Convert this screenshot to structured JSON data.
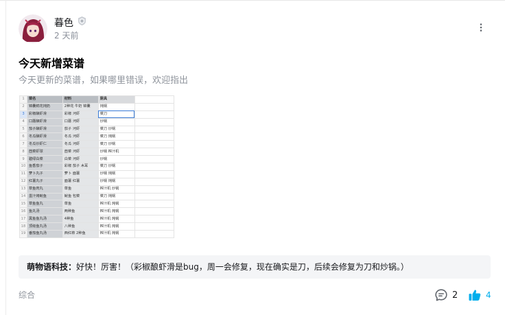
{
  "author": {
    "name": "暮色",
    "time": "2 天前"
  },
  "post": {
    "title": "今天新增菜谱",
    "description": "今天更新的菜谱，如果哪里错误，欢迎指出"
  },
  "sheet": {
    "headers": [
      "菜名",
      "材料",
      "厨具"
    ],
    "rows": [
      {
        "n": "1",
        "name": "",
        "mat": "",
        "tool": ""
      },
      {
        "n": "2",
        "name": "锦囊鲜花炖奶",
        "mat": "2种花 牛奶 锦囊",
        "tool": "炖锅"
      },
      {
        "n": "3",
        "name": "彩椒酿虾滑",
        "mat": "彩椒 河虾",
        "tool": "菜刀"
      },
      {
        "n": "4",
        "name": "口蘑酿虾滑",
        "mat": "口蘑 河虾",
        "tool": "炒锅"
      },
      {
        "n": "5",
        "name": "茄子酿虾滑",
        "mat": "茄子 河虾",
        "tool": "菜刀 炒锅"
      },
      {
        "n": "6",
        "name": "冬瓜酿虾滑",
        "mat": "冬瓜 河虾",
        "tool": "菜刀 炖锅"
      },
      {
        "n": "7",
        "name": "冬瓜炒虾仁",
        "mat": "冬瓜 河虾",
        "tool": "菜刀 炒锅"
      },
      {
        "n": "8",
        "name": "茴菜虾球",
        "mat": "茴菜 河虾",
        "tool": "炒锅 榨汁机"
      },
      {
        "n": "9",
        "name": "碧绿白菜",
        "mat": "白菜 河虾",
        "tool": "炒锅"
      },
      {
        "n": "10",
        "name": "鱼香茄子",
        "mat": "彩椒 茄子 木耳",
        "tool": "菜刀 炒锅"
      },
      {
        "n": "11",
        "name": "萝卜丸子",
        "mat": "萝卜 面薯",
        "tool": "炒锅 炖锅"
      },
      {
        "n": "12",
        "name": "红薯丸子",
        "mat": "面薯 红薯",
        "tool": "炒锅 炖锅"
      },
      {
        "n": "13",
        "name": "草鱼肉丸",
        "mat": "草鱼",
        "tool": "榨汁机 炒锅"
      },
      {
        "n": "14",
        "name": "墨汁烤鱿鱼",
        "mat": "鱿鱼 包菜",
        "tool": "菜刀 炖锅"
      },
      {
        "n": "15",
        "name": "草鱼鱼丸",
        "mat": "草鱼",
        "tool": "榨汁机 炖锅"
      },
      {
        "n": "16",
        "name": "鱼丸汤",
        "mat": "两种鱼",
        "tool": "榨汁机 炖锅"
      },
      {
        "n": "17",
        "name": "黑鱼鱼丸汤",
        "mat": "4种鱼",
        "tool": "榨汁机 炖锅"
      },
      {
        "n": "18",
        "name": "顶级鱼丸汤",
        "mat": "八种鱼",
        "tool": "榨汁机 炖锅"
      },
      {
        "n": "19",
        "name": "番茄鱼丸汤",
        "mat": "西红柿 2种鱼",
        "tool": "榨汁机 炖锅"
      }
    ]
  },
  "reply": {
    "name": "萌物语科技：",
    "text": "好快！厉害！（彩椒酿虾滑是bug，周一会修复，现在确实是刀，后续会修复为刀和炒锅。）"
  },
  "footer": {
    "category": "综合",
    "comment_count": "2",
    "like_count": "4"
  },
  "colors": {
    "accent": "#00aeec",
    "reply_bg": "#f4f5f7"
  },
  "icons": {
    "badge": "verified-badge-icon",
    "more": "more-vertical-icon",
    "comment": "comment-icon",
    "like": "thumbs-up-icon"
  }
}
